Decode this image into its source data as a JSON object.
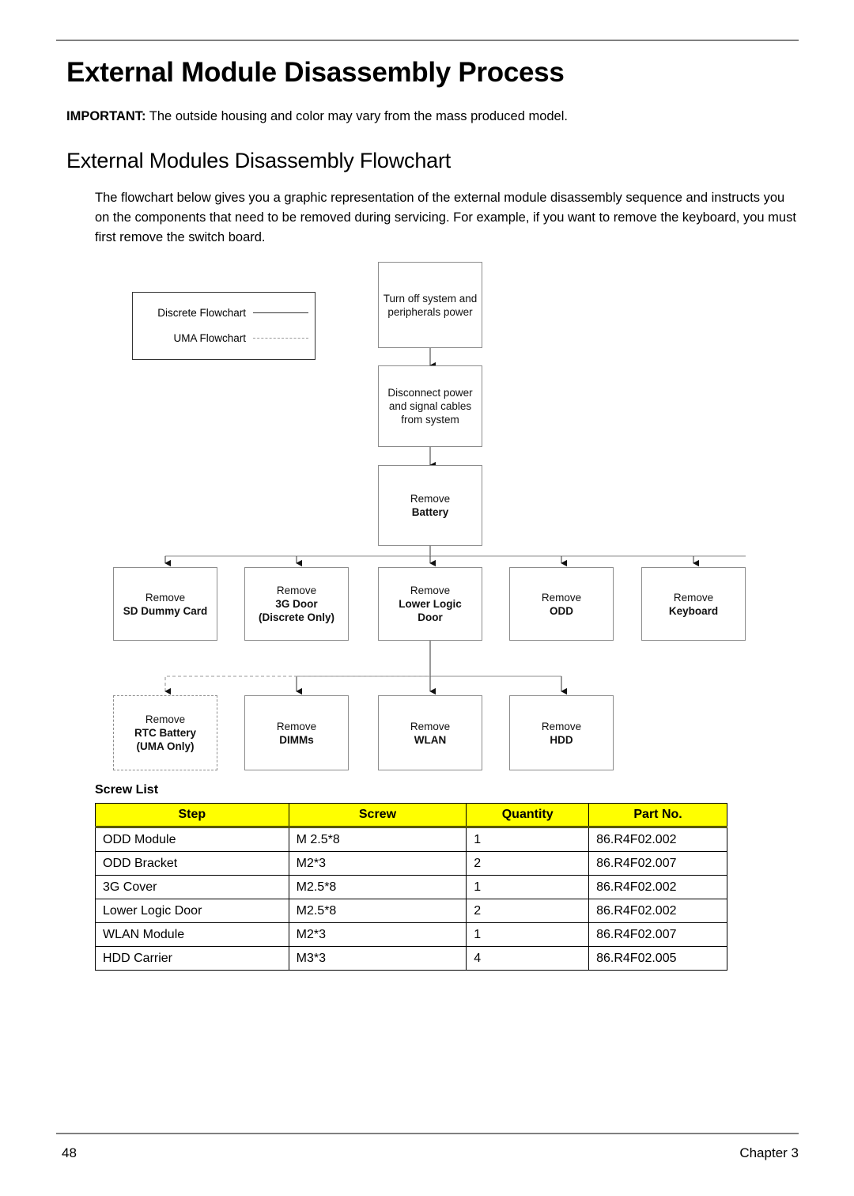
{
  "page": {
    "title": "External Module Disassembly Process",
    "important_label": "IMPORTANT:",
    "important_text": " The outside housing and color may vary from the mass produced model.",
    "section_title": "External Modules Disassembly Flowchart",
    "body_paragraph": "The flowchart below gives you a graphic representation of the external module disassembly sequence and instructs you on the components that need to be removed during servicing. For example, if you want to remove the keyboard, you must first remove the switch board."
  },
  "legend": {
    "discrete_label": "Discrete Flowchart",
    "uma_label": "UMA Flowchart"
  },
  "flowchart": {
    "start": {
      "line1": "Turn off system and",
      "line2": "peripherals power"
    },
    "disconnect": {
      "line1": "Disconnect power",
      "line2": "and signal cables",
      "line3": "from system"
    },
    "battery": {
      "line1": "Remove",
      "line2": "Battery"
    },
    "row1": [
      {
        "line1": "Remove",
        "line2": "SD Dummy Card",
        "line3": ""
      },
      {
        "line1": "Remove",
        "line2": "3G Door",
        "line3": "(Discrete Only)"
      },
      {
        "line1": "Remove",
        "line2": "Lower Logic",
        "line3": "Door"
      },
      {
        "line1": "Remove",
        "line2": "ODD",
        "line3": ""
      },
      {
        "line1": "Remove",
        "line2": "Keyboard",
        "line3": ""
      }
    ],
    "row2": [
      {
        "line1": "Remove",
        "line2": "RTC Battery",
        "line3": "(UMA Only)"
      },
      {
        "line1": "Remove",
        "line2": "DIMMs",
        "line3": ""
      },
      {
        "line1": "Remove",
        "line2": "WLAN",
        "line3": ""
      },
      {
        "line1": "Remove",
        "line2": "HDD",
        "line3": ""
      }
    ]
  },
  "screw_list": {
    "heading": "Screw List",
    "columns": [
      "Step",
      "Screw",
      "Quantity",
      "Part No."
    ],
    "rows": [
      [
        "ODD Module",
        "M 2.5*8",
        "1",
        "86.R4F02.002"
      ],
      [
        "ODD Bracket",
        "M2*3",
        "2",
        "86.R4F02.007"
      ],
      [
        "3G Cover",
        "M2.5*8",
        "1",
        "86.R4F02.002"
      ],
      [
        "Lower Logic Door",
        "M2.5*8",
        "2",
        "86.R4F02.002"
      ],
      [
        "WLAN Module",
        "M2*3",
        "1",
        "86.R4F02.007"
      ],
      [
        "HDD Carrier",
        "M3*3",
        "4",
        "86.R4F02.005"
      ]
    ]
  },
  "footer": {
    "page_number": "48",
    "chapter": "Chapter 3"
  },
  "colors": {
    "table_header_bg": "#FFFF00",
    "rule": "#808080",
    "box_border": "#8C8C8C"
  }
}
